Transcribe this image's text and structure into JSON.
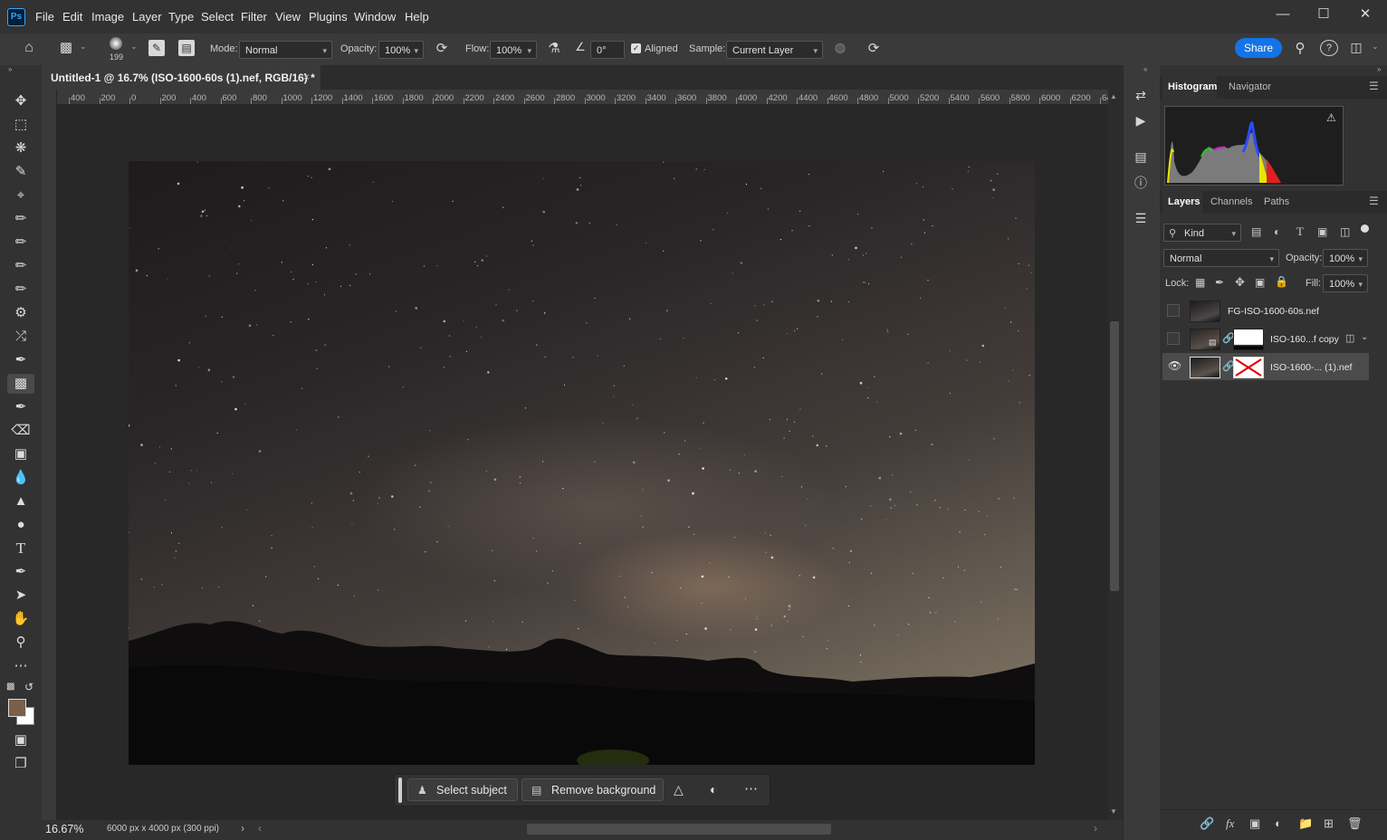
{
  "menubar": {
    "app_icon": "Ps",
    "items": [
      "File",
      "Edit",
      "Image",
      "Layer",
      "Type",
      "Select",
      "Filter",
      "View",
      "Plugins",
      "Window",
      "Help"
    ]
  },
  "options": {
    "brush_size": "199",
    "mode_label": "Mode:",
    "mode_value": "Normal",
    "opacity_label": "Opacity:",
    "opacity_value": "100%",
    "flow_label": "Flow:",
    "flow_value": "100%",
    "angle_value": "0°",
    "aligned_label": "Aligned",
    "aligned_checked": true,
    "sample_label": "Sample:",
    "sample_value": "Current Layer",
    "share_label": "Share"
  },
  "document": {
    "tab_title": "Untitled-1 @ 16.7% (ISO-1600-60s (1).nef, RGB/16) *",
    "ruler_ticks": [
      "400",
      "200",
      "0",
      "200",
      "400",
      "600",
      "800",
      "1000",
      "1200",
      "1400",
      "1600",
      "1800",
      "2000",
      "2200",
      "2400",
      "2600",
      "2800",
      "3000",
      "3200",
      "3400",
      "3600",
      "3800",
      "4000",
      "4200",
      "4400",
      "4600",
      "4800",
      "5000",
      "5200",
      "5400",
      "5600",
      "5800",
      "6000",
      "6200",
      "64"
    ],
    "zoom": "16.67%",
    "doc_info": "6000 px x 4000 px (300 ppi)"
  },
  "taskbar": {
    "select_subject": "Select subject",
    "remove_background": "Remove background"
  },
  "panels": {
    "top_tabs": [
      "Histogram",
      "Navigator"
    ],
    "layer_tabs": [
      "Layers",
      "Channels",
      "Paths"
    ],
    "filter_kind": "Kind",
    "blend_mode": "Normal",
    "opacity_label": "Opacity:",
    "opacity_value": "100%",
    "lock_label": "Lock:",
    "fill_label": "Fill:",
    "fill_value": "100%",
    "layers": [
      {
        "name": "FG-ISO-1600-60s.nef",
        "visible": false,
        "selected": false
      },
      {
        "name": "ISO-160...f copy",
        "visible": false,
        "selected": false
      },
      {
        "name": "ISO-1600-... (1).nef",
        "visible": true,
        "selected": true
      }
    ]
  },
  "colors": {
    "accent": "#1473e6",
    "foreground_swatch": "#7a5f4b",
    "background_swatch": "#ffffff"
  }
}
